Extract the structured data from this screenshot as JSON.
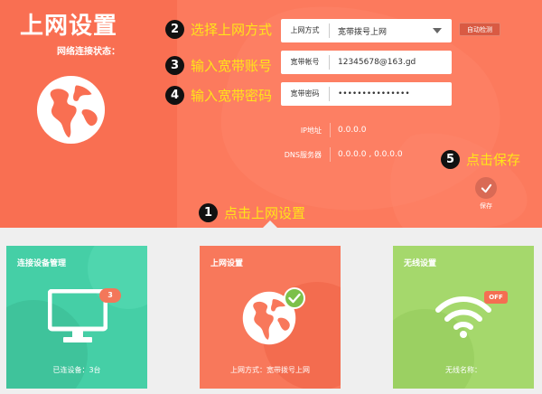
{
  "header": {
    "title": "上网设置",
    "status_label": "网络连接状态："
  },
  "annotations": [
    {
      "num": "1",
      "text": "点击上网设置"
    },
    {
      "num": "2",
      "text": "选择上网方式"
    },
    {
      "num": "3",
      "text": "输入宽带账号"
    },
    {
      "num": "4",
      "text": "输入宽带密码"
    },
    {
      "num": "5",
      "text": "点击保存"
    }
  ],
  "form": {
    "mode_label": "上网方式",
    "mode_value": "宽带拨号上网",
    "detect_button": "自动检测",
    "account_label": "宽带帐号",
    "account_value": "12345678@163.gd",
    "password_label": "宽带密码",
    "password_value": "•••••••••••••••"
  },
  "info": {
    "ip_label": "IP地址",
    "ip_value": "0.0.0.0",
    "dns_label": "DNS服务器",
    "dns_value": "0.0.0.0 , 0.0.0.0"
  },
  "save": {
    "label": "保存"
  },
  "cards": {
    "devices": {
      "title": "连接设备管理",
      "badge": "3",
      "footer": "已连设备：3台"
    },
    "network": {
      "title": "上网设置",
      "footer": "上网方式：宽带拨号上网"
    },
    "wireless": {
      "title": "无线设置",
      "badge": "OFF",
      "footer": "无线名称："
    }
  },
  "colors": {
    "header_bg": "#fc7a5d",
    "accent_text": "#ffe41a",
    "devices_card": "#45cfa6",
    "network_card": "#f8785b",
    "wireless_card": "#a5d86c"
  }
}
